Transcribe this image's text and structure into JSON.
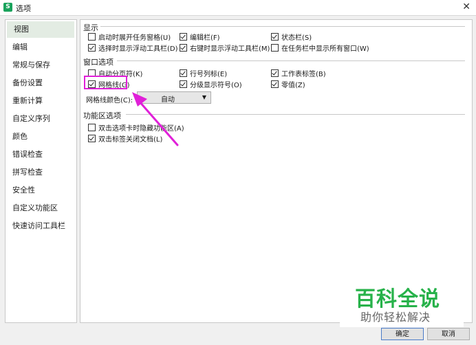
{
  "window": {
    "title": "选项",
    "close_icon": "close-icon"
  },
  "sidebar": {
    "items": [
      {
        "label": "视图",
        "active": true
      },
      {
        "label": "编辑"
      },
      {
        "label": "常规与保存"
      },
      {
        "label": "备份设置"
      },
      {
        "label": "重新计算"
      },
      {
        "label": "自定义序列"
      },
      {
        "label": "颜色"
      },
      {
        "label": "错误检查"
      },
      {
        "label": "拼写检查"
      },
      {
        "label": "安全性"
      },
      {
        "label": "自定义功能区"
      },
      {
        "label": "快速访问工具栏"
      }
    ]
  },
  "display": {
    "title": "显示",
    "options": [
      {
        "label": "启动时展开任务窗格(U)",
        "checked": false
      },
      {
        "label": "编辑栏(F)",
        "checked": true
      },
      {
        "label": "状态栏(S)",
        "checked": true
      },
      {
        "label": "选择时显示浮动工具栏(D)",
        "checked": true
      },
      {
        "label": "右键时显示浮动工具栏(M)",
        "checked": true
      },
      {
        "label": "在任务栏中显示所有窗口(W)",
        "checked": false
      }
    ]
  },
  "window_options": {
    "title": "窗口选项",
    "options": [
      {
        "label": "自动分页符(K)",
        "checked": false
      },
      {
        "label": "行号列标(E)",
        "checked": true
      },
      {
        "label": "工作表标签(B)",
        "checked": true
      },
      {
        "label": "网格线(G)",
        "checked": true
      },
      {
        "label": "分级显示符号(O)",
        "checked": true
      },
      {
        "label": "零值(Z)",
        "checked": true
      }
    ],
    "gridline_color_label": "网格线颜色(C):",
    "gridline_color_value": "自动"
  },
  "ribbon": {
    "title": "功能区选项",
    "options": [
      {
        "label": "双击选项卡时隐藏功能区(A)",
        "checked": false
      },
      {
        "label": "双击标签关闭文档(L)",
        "checked": true
      }
    ]
  },
  "watermark": {
    "title": "百科全说",
    "subtitle": "助你轻松解决"
  },
  "footer": {
    "ok_label": "确定",
    "cancel_label": "取消"
  },
  "colors": {
    "highlight": "#e020d8",
    "arrow": "#e020d8",
    "watermark_green": "#27b24a"
  }
}
